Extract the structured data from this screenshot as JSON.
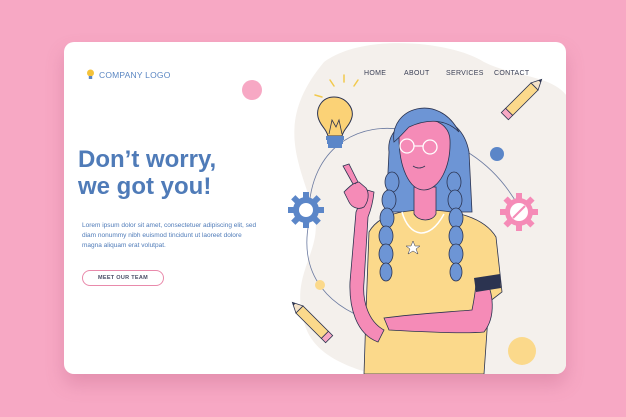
{
  "logo": {
    "text": "COMPANY LOGO"
  },
  "nav": {
    "home": "HOME",
    "about": "ABOUT",
    "services": "SERVICES",
    "contact": "CONTACT"
  },
  "hero": {
    "line1": "Don’t worry,",
    "line2": "we got you!",
    "body_line1": "Lorem ipsum dolor sit amet, consectetuer adipiscing elit, sed",
    "body_line2": "diam nonummy nibh euismod tincidunt ut laoreet dolore",
    "body_line3": "magna aliquam erat volutpat.",
    "cta": "MEET OUR TEAM"
  },
  "colors": {
    "background": "#f7a8c4",
    "card": "#ffffff",
    "accent_blue": "#4f7bb8",
    "shirt_yellow": "#fbd98b",
    "skin_pink": "#f58bb7",
    "hair_blue": "#6d95d5",
    "blob": "#f4f0ec"
  },
  "icons": [
    "lightbulb-icon",
    "gear-icon",
    "gear-icon",
    "pencil-icon",
    "pencil-icon"
  ]
}
